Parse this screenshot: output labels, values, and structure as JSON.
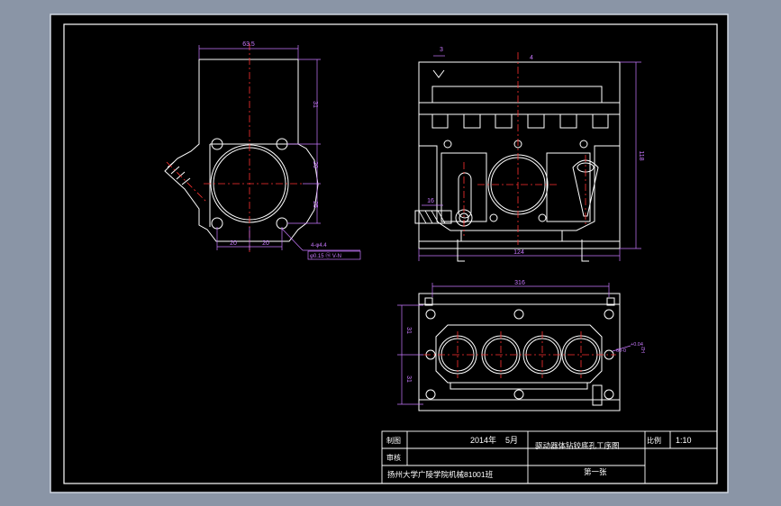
{
  "colors": {
    "background_outer": "#8a95a6",
    "paper": "#000000",
    "line": "#ffffff",
    "dimension": "#c878ff",
    "centerline": "#ff3030",
    "hatch": "#ffffff"
  },
  "left_view": {
    "dim_width": "63.5",
    "dim_v1": "31",
    "dim_v2": "20",
    "dim_v3": "25",
    "dim_h1": "20",
    "dim_h2": "20",
    "holes_note": "4-φ4.4",
    "tolerance_frame": "φ0.15 ⓜ V-N"
  },
  "right_top_view": {
    "dim_small": "3",
    "dim_top": "4",
    "dim_side": "16",
    "dim_height": "118",
    "dim_width": "124"
  },
  "right_bottom_view": {
    "dim_width": "316",
    "dim_v1": "31",
    "dim_v2": "31",
    "tolerance_note1": "+0.04",
    "tolerance_note2": "60-0",
    "tolerance_note3": "H2"
  },
  "title_block": {
    "row1_label": "制图",
    "row2_label": "审核",
    "date_year": "2014年",
    "date_month": "5月",
    "drawing_title": "驱动器体钻铰底孔工序图",
    "scale_label": "比例",
    "scale_value": "1:10",
    "school": "扬州大学广陵学院机械81001班",
    "sheet": "第一张"
  }
}
